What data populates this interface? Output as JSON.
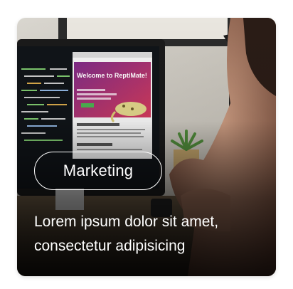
{
  "card": {
    "category": "Marketing",
    "headline": "Lorem ipsum dolor sit amet, consectetur adipisicing"
  },
  "screen": {
    "site_heading": "Welcome to ReptiMate!"
  },
  "colors": {
    "card_text": "#ffffff",
    "site_banner": "#b0306a",
    "code_green": "#7ec86e",
    "background": "#ffffff"
  }
}
